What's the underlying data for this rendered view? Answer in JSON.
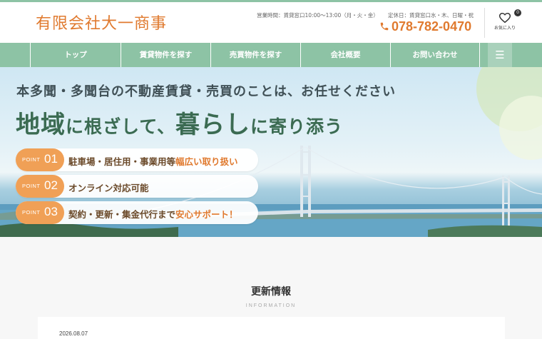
{
  "header": {
    "logo": "有限会社大一商事",
    "hours": "営業時間：賃貸窓口10:00〜13:00（月・火・金）",
    "closed": "定休日：賃貸窓口水・木、日曜・祝",
    "phone": "078-782-0470",
    "phone_icon": "phone-icon",
    "favorites": {
      "label": "お気に入り",
      "count": "0",
      "icon": "heart-icon"
    }
  },
  "nav": {
    "items": [
      {
        "label": "トップ"
      },
      {
        "label": "賃貸物件を探す"
      },
      {
        "label": "売買物件を探す"
      },
      {
        "label": "会社概要"
      },
      {
        "label": "お問い合わせ"
      }
    ],
    "menu_icon": "hamburger-menu-icon"
  },
  "hero": {
    "subtitle": "本多聞・多聞台の不動産賃貸・売買のことは、お任せください",
    "headline": {
      "part1": "地域",
      "part2": "に根ざして、",
      "part3": "暮らし",
      "part4": "に寄り添う"
    },
    "points": [
      {
        "word": "POINT",
        "num": "01",
        "text": "駐車場・居住用・事業用等",
        "emph": "幅広い取り扱い"
      },
      {
        "word": "POINT",
        "num": "02",
        "text": "オンライン対応可能",
        "emph": ""
      },
      {
        "word": "POINT",
        "num": "03",
        "text": "契約・更新・集金代行まで",
        "emph": "安心サポート！"
      }
    ]
  },
  "news": {
    "title": "更新情報",
    "subtitle": "INFORMATION",
    "items": [
      {
        "date": "2026.08.07"
      }
    ]
  },
  "colors": {
    "accent": "#e07a2f",
    "nav_green": "#8dc3a5",
    "headline_green": "#3b6b52",
    "point_orange": "#f0a056"
  }
}
